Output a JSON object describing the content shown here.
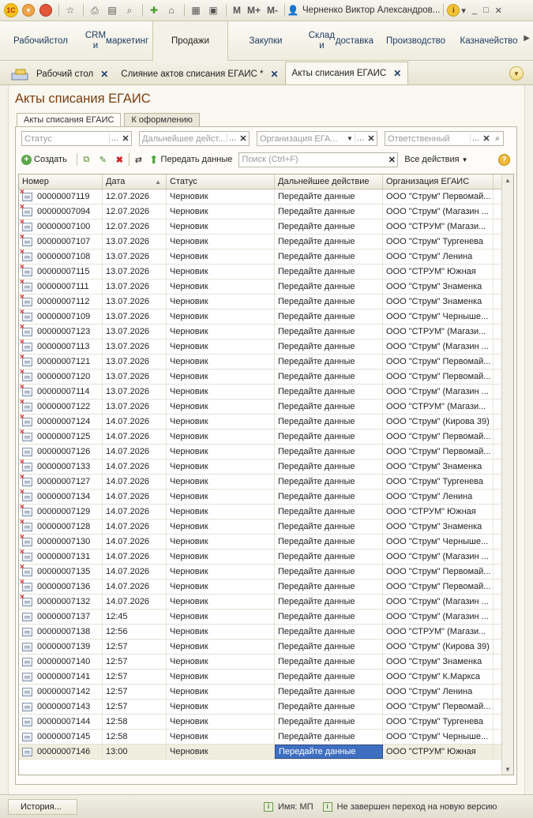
{
  "toolbar": {
    "user_name": "Черненко Виктор Александров...",
    "m_labels": [
      "M",
      "M+",
      "M-"
    ]
  },
  "sections": [
    {
      "label": "Рабочий стол",
      "line1": "Рабочий",
      "line2": "стол"
    },
    {
      "label": "CRM и маркетинг",
      "line1": "CRM и",
      "line2": "маркетинг"
    },
    {
      "label": "Продажи",
      "line1": "Продажи",
      "line2": ""
    },
    {
      "label": "Закупки",
      "line1": "Закупки",
      "line2": ""
    },
    {
      "label": "Склад и доставка",
      "line1": "Склад и",
      "line2": "доставка"
    },
    {
      "label": "Производство",
      "line1": "Производство",
      "line2": ""
    },
    {
      "label": "Казначейство",
      "line1": "Казначейство",
      "line2": ""
    }
  ],
  "active_section": "Продажи",
  "window_tabs": [
    {
      "label": "Рабочий стол"
    },
    {
      "label": "Слияние актов списания ЕГАИС *"
    },
    {
      "label": "Акты списания ЕГАИС"
    }
  ],
  "form": {
    "title": "Акты списания ЕГАИС",
    "tabs": [
      "Акты списания ЕГАИС",
      "К оформлению"
    ]
  },
  "filters": {
    "status_placeholder": "Статус",
    "next_action_placeholder": "Дальнейшее дейст...",
    "organization_placeholder": "Организация ЕГА...",
    "responsible_placeholder": "Ответственный"
  },
  "commands": {
    "create": "Создать",
    "send_data": "Передать данные",
    "search_placeholder": "Поиск (Ctrl+F)",
    "all_actions": "Все действия"
  },
  "table": {
    "columns": [
      "Номер",
      "Дата",
      "Статус",
      "Дальнейшее действие",
      "Организация ЕГАИС"
    ],
    "rows": [
      {
        "icon": "deleted",
        "number": "00000007119",
        "date": "12.07.2026",
        "status": "Черновик",
        "action": "Передайте данные",
        "org": "ООО \"Струм\" Первомай..."
      },
      {
        "icon": "deleted",
        "number": "00000007094",
        "date": "12.07.2026",
        "status": "Черновик",
        "action": "Передайте данные",
        "org": "ООО \"Струм\" (Магазин ..."
      },
      {
        "icon": "deleted",
        "number": "00000007100",
        "date": "12.07.2026",
        "status": "Черновик",
        "action": "Передайте данные",
        "org": "ООО \"СТРУМ\" (Магази..."
      },
      {
        "icon": "deleted",
        "number": "00000007107",
        "date": "13.07.2026",
        "status": "Черновик",
        "action": "Передайте данные",
        "org": "ООО \"Струм\" Тургенева"
      },
      {
        "icon": "deleted",
        "number": "00000007108",
        "date": "13.07.2026",
        "status": "Черновик",
        "action": "Передайте данные",
        "org": "ООО \"Струм\" Ленина"
      },
      {
        "icon": "deleted",
        "number": "00000007115",
        "date": "13.07.2026",
        "status": "Черновик",
        "action": "Передайте данные",
        "org": "ООО \"СТРУМ\" Южная"
      },
      {
        "icon": "deleted",
        "number": "00000007111",
        "date": "13.07.2026",
        "status": "Черновик",
        "action": "Передайте данные",
        "org": "ООО \"Струм\" Знаменка"
      },
      {
        "icon": "deleted",
        "number": "00000007112",
        "date": "13.07.2026",
        "status": "Черновик",
        "action": "Передайте данные",
        "org": "ООО \"Струм\" Знаменка"
      },
      {
        "icon": "deleted",
        "number": "00000007109",
        "date": "13.07.2026",
        "status": "Черновик",
        "action": "Передайте данные",
        "org": "ООО \"Струм\" Черныше..."
      },
      {
        "icon": "deleted",
        "number": "00000007123",
        "date": "13.07.2026",
        "status": "Черновик",
        "action": "Передайте данные",
        "org": "ООО \"СТРУМ\" (Магази..."
      },
      {
        "icon": "deleted",
        "number": "00000007113",
        "date": "13.07.2026",
        "status": "Черновик",
        "action": "Передайте данные",
        "org": "ООО \"Струм\" (Магазин ..."
      },
      {
        "icon": "deleted",
        "number": "00000007121",
        "date": "13.07.2026",
        "status": "Черновик",
        "action": "Передайте данные",
        "org": "ООО \"Струм\" Первомай..."
      },
      {
        "icon": "deleted",
        "number": "00000007120",
        "date": "13.07.2026",
        "status": "Черновик",
        "action": "Передайте данные",
        "org": "ООО \"Струм\" Первомай..."
      },
      {
        "icon": "deleted",
        "number": "00000007114",
        "date": "13.07.2026",
        "status": "Черновик",
        "action": "Передайте данные",
        "org": "ООО \"Струм\" (Магазин ..."
      },
      {
        "icon": "deleted",
        "number": "00000007122",
        "date": "13.07.2026",
        "status": "Черновик",
        "action": "Передайте данные",
        "org": "ООО \"СТРУМ\" (Магази..."
      },
      {
        "icon": "deleted",
        "number": "00000007124",
        "date": "14.07.2026",
        "status": "Черновик",
        "action": "Передайте данные",
        "org": "ООО \"Струм\" (Кирова 39)"
      },
      {
        "icon": "deleted",
        "number": "00000007125",
        "date": "14.07.2026",
        "status": "Черновик",
        "action": "Передайте данные",
        "org": "ООО \"Струм\" Первомай..."
      },
      {
        "icon": "doc",
        "number": "00000007126",
        "date": "14.07.2026",
        "status": "Черновик",
        "action": "Передайте данные",
        "org": "ООО \"Струм\" Первомай..."
      },
      {
        "icon": "deleted",
        "number": "00000007133",
        "date": "14.07.2026",
        "status": "Черновик",
        "action": "Передайте данные",
        "org": "ООО \"Струм\" Знаменка"
      },
      {
        "icon": "deleted",
        "number": "00000007127",
        "date": "14.07.2026",
        "status": "Черновик",
        "action": "Передайте данные",
        "org": "ООО \"Струм\" Тургенева"
      },
      {
        "icon": "deleted",
        "number": "00000007134",
        "date": "14.07.2026",
        "status": "Черновик",
        "action": "Передайте данные",
        "org": "ООО \"Струм\" Ленина"
      },
      {
        "icon": "deleted",
        "number": "00000007129",
        "date": "14.07.2026",
        "status": "Черновик",
        "action": "Передайте данные",
        "org": "ООО \"СТРУМ\" Южная"
      },
      {
        "icon": "deleted",
        "number": "00000007128",
        "date": "14.07.2026",
        "status": "Черновик",
        "action": "Передайте данные",
        "org": "ООО \"Струм\" Знаменка"
      },
      {
        "icon": "deleted",
        "number": "00000007130",
        "date": "14.07.2026",
        "status": "Черновик",
        "action": "Передайте данные",
        "org": "ООО \"Струм\" Черныше..."
      },
      {
        "icon": "deleted",
        "number": "00000007131",
        "date": "14.07.2026",
        "status": "Черновик",
        "action": "Передайте данные",
        "org": "ООО \"Струм\" (Магазин ..."
      },
      {
        "icon": "deleted",
        "number": "00000007135",
        "date": "14.07.2026",
        "status": "Черновик",
        "action": "Передайте данные",
        "org": "ООО \"Струм\" Первомай..."
      },
      {
        "icon": "deleted",
        "number": "00000007136",
        "date": "14.07.2026",
        "status": "Черновик",
        "action": "Передайте данные",
        "org": "ООО \"Струм\" Первомай..."
      },
      {
        "icon": "deleted",
        "number": "00000007132",
        "date": "14.07.2026",
        "status": "Черновик",
        "action": "Передайте данные",
        "org": "ООО \"Струм\" (Магазин ..."
      },
      {
        "icon": "doc",
        "number": "00000007137",
        "date": "12:45",
        "status": "Черновик",
        "action": "Передайте данные",
        "org": "ООО \"Струм\" (Магазин ..."
      },
      {
        "icon": "doc",
        "number": "00000007138",
        "date": "12:56",
        "status": "Черновик",
        "action": "Передайте данные",
        "org": "ООО \"СТРУМ\" (Магази..."
      },
      {
        "icon": "doc",
        "number": "00000007139",
        "date": "12:57",
        "status": "Черновик",
        "action": "Передайте данные",
        "org": "ООО \"Струм\" (Кирова 39)"
      },
      {
        "icon": "doc",
        "number": "00000007140",
        "date": "12:57",
        "status": "Черновик",
        "action": "Передайте данные",
        "org": "ООО \"Струм\" Знаменка"
      },
      {
        "icon": "doc",
        "number": "00000007141",
        "date": "12:57",
        "status": "Черновик",
        "action": "Передайте данные",
        "org": "ООО \"Струм\" К.Маркса"
      },
      {
        "icon": "doc",
        "number": "00000007142",
        "date": "12:57",
        "status": "Черновик",
        "action": "Передайте данные",
        "org": "ООО \"Струм\" Ленина"
      },
      {
        "icon": "doc",
        "number": "00000007143",
        "date": "12:57",
        "status": "Черновик",
        "action": "Передайте данные",
        "org": "ООО \"Струм\" Первомай..."
      },
      {
        "icon": "doc",
        "number": "00000007144",
        "date": "12:58",
        "status": "Черновик",
        "action": "Передайте данные",
        "org": "ООО \"Струм\" Тургенева"
      },
      {
        "icon": "doc",
        "number": "00000007145",
        "date": "12:58",
        "status": "Черновик",
        "action": "Передайте данные",
        "org": "ООО \"Струм\" Черныше..."
      },
      {
        "icon": "doc",
        "number": "00000007146",
        "date": "13:00",
        "status": "Черновик",
        "action": "Передайте данные",
        "org": "ООО \"СТРУМ\" Южная",
        "selected": true
      }
    ]
  },
  "statusbar": {
    "history": "История...",
    "name_label": "Имя: MП",
    "version_notice": "Не завершен переход на новую версию"
  }
}
